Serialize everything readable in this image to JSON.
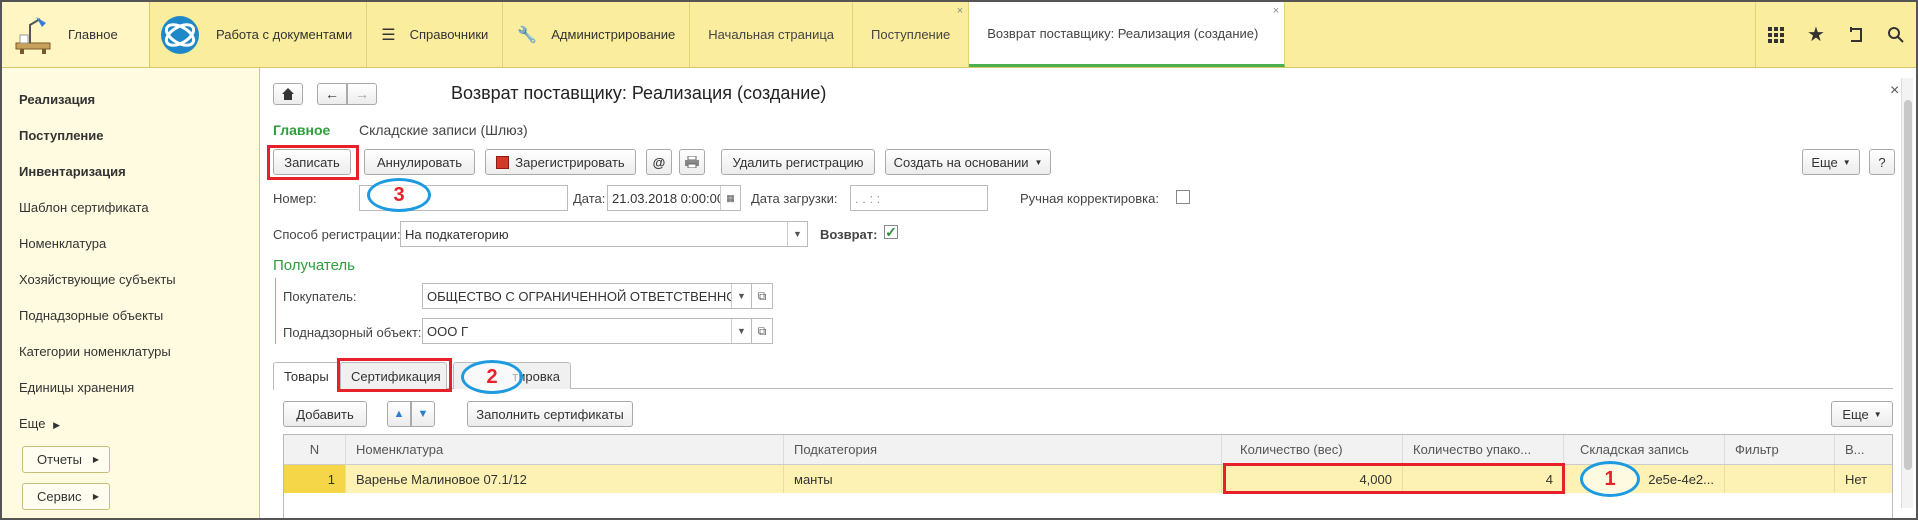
{
  "topbar": {
    "home_label": "Главное",
    "sections": [
      "Работа с документами",
      "Справочники",
      "Администрирование"
    ],
    "tabs": [
      {
        "label": "Начальная страница"
      },
      {
        "label": "Поступление",
        "close": "×"
      },
      {
        "label": "Возврат поставщику: Реализация (создание)",
        "close": "×"
      }
    ],
    "icons": [
      "grid-icon",
      "star-icon",
      "history-icon",
      "search-icon"
    ]
  },
  "sidebar": {
    "items": [
      {
        "label": "Реализация",
        "bold": true
      },
      {
        "label": "Поступление",
        "bold": true
      },
      {
        "label": "Инвентаризация",
        "bold": true
      },
      {
        "label": "Шаблон сертификата"
      },
      {
        "label": "Номенклатура"
      },
      {
        "label": "Хозяйствующие субъекты"
      },
      {
        "label": "Поднадзорные объекты"
      },
      {
        "label": "Категории номенклатуры"
      },
      {
        "label": "Единицы хранения"
      }
    ],
    "more": "Еще",
    "reports": "Отчеты",
    "service": "Сервис"
  },
  "form": {
    "title": "Возврат поставщику: Реализация (создание)",
    "close": "×",
    "subtabs": [
      "Главное",
      "Складские записи (Шлюз)"
    ],
    "toolbar": {
      "save": "Записать",
      "cancel": "Аннулировать",
      "register": "Зарегистрировать",
      "at": "@",
      "delete_reg": "Удалить регистрацию",
      "create_based": "Создать на основании",
      "more": "Еще",
      "help": "?"
    },
    "number_label": "Номер:",
    "number_value": "",
    "date_label": "Дата:",
    "date_value": "21.03.2018  0:00:00",
    "load_date_label": "Дата загрузки:",
    "load_date_value": " .  .        :  :",
    "manual_label": "Ручная корректировка:",
    "reg_method_label": "Способ регистрации:",
    "reg_method_value": "На подкатегорию",
    "return_label": "Возврат:",
    "recipient_heading": "Получатель",
    "buyer_label": "Покупатель:",
    "buyer_value": "ОБЩЕСТВО С ОГРАНИЧЕННОЙ ОТВЕТСТВЕННОСТЬЮ \"Т",
    "object_label": "Поднадзорный объект:",
    "object_value": "ООО Г"
  },
  "tabs": {
    "goods": "Товары",
    "cert": "Сертификация",
    "third": "тировка"
  },
  "table_toolbar": {
    "add": "Добавить",
    "fill": "Заполнить сертификаты",
    "more": "Еще"
  },
  "table": {
    "headers": [
      "N",
      "Номенклатура",
      "Подкатегория",
      "Количество (вес)",
      "Количество упако...",
      "Складская запись",
      "Фильтр",
      "В..."
    ],
    "row": {
      "n": "1",
      "nomenclature": "Варенье Малиновое 07.1/12",
      "subcategory": "манты",
      "qty_weight": "4,000",
      "qty_pack": "4",
      "stock_record": "2e5e-4e2...",
      "filter": "",
      "v": "Нет"
    }
  },
  "annotations": {
    "one": "1",
    "two": "2",
    "three": "3"
  }
}
